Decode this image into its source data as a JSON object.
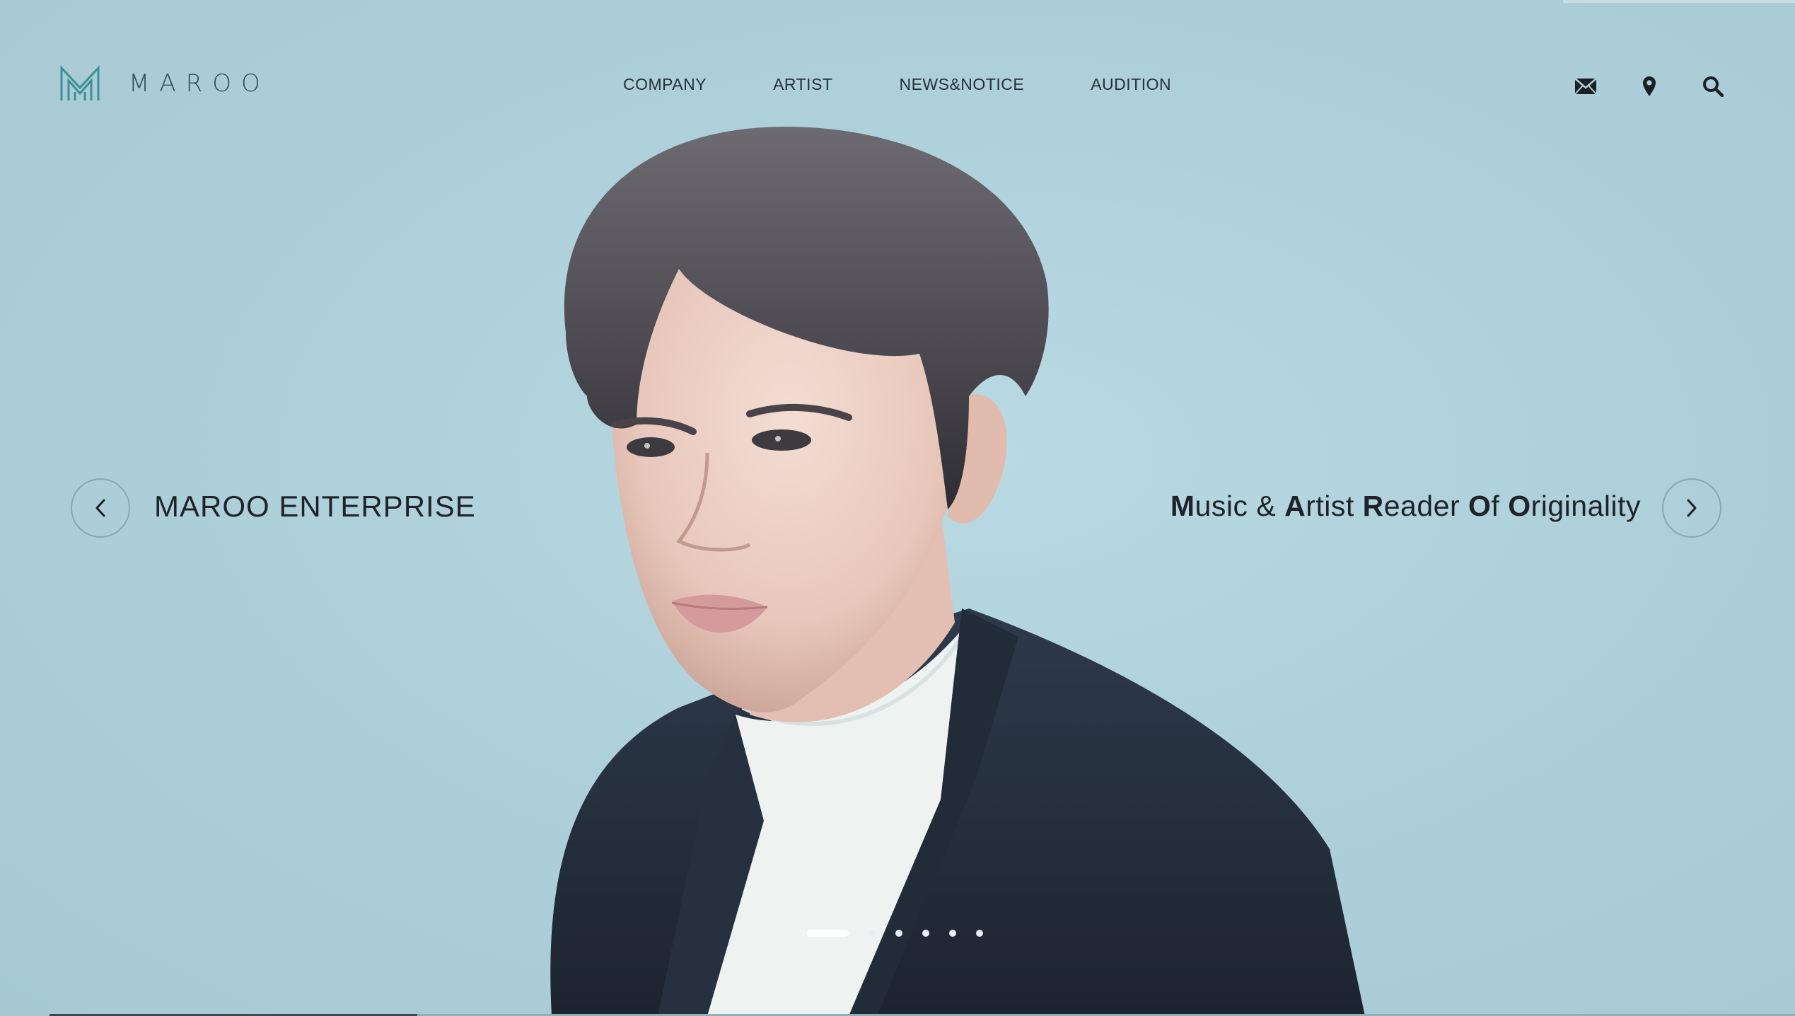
{
  "brand": {
    "name": "MAROO",
    "accent_color": "#3c8f93"
  },
  "nav": {
    "items": [
      "COMPANY",
      "ARTIST",
      "NEWS&NOTICE",
      "AUDITION"
    ]
  },
  "header_icons": [
    "mail-icon",
    "location-pin-icon",
    "search-icon"
  ],
  "hero": {
    "left_caption": "MAROO ENTERPRISE",
    "right_tagline": [
      {
        "bold": "M",
        "rest": "usic & "
      },
      {
        "bold": "A",
        "rest": "rtist "
      },
      {
        "bold": "R",
        "rest": "eader "
      },
      {
        "bold": "O",
        "rest": "f "
      },
      {
        "bold": "O",
        "rest": "riginality"
      }
    ],
    "slide_count": 6,
    "active_slide": 1,
    "background_color": "#aecfd9"
  }
}
